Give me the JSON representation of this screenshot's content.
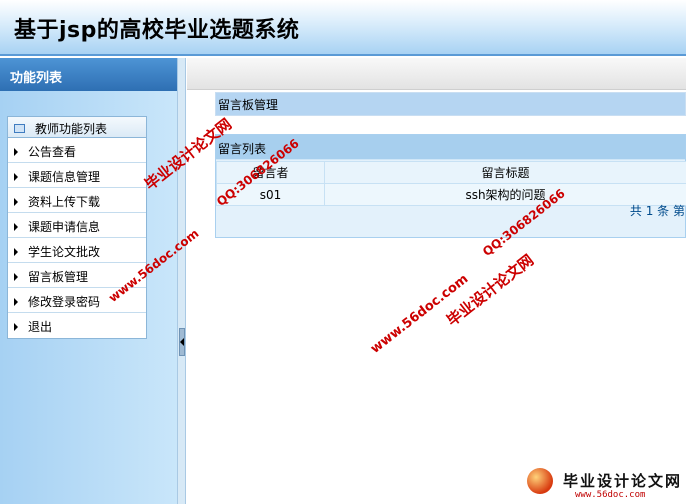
{
  "header": {
    "title": "基于jsp的高校毕业选题系统"
  },
  "sidebar": {
    "title": "功能列表",
    "group_label": "教师功能列表",
    "items": [
      {
        "label": "公告查看"
      },
      {
        "label": "课题信息管理"
      },
      {
        "label": "资料上传下载"
      },
      {
        "label": "课题申请信息"
      },
      {
        "label": "学生论文批改"
      },
      {
        "label": "留言板管理"
      },
      {
        "label": "修改登录密码"
      },
      {
        "label": "退出"
      }
    ]
  },
  "main": {
    "section_title": "留言板管理",
    "list_title": "留言列表",
    "columns": [
      "留言者",
      "留言标题"
    ],
    "rows": [
      {
        "author": "s01",
        "subject": "ssh架构的问题"
      }
    ],
    "pager": "共 1 条 第"
  },
  "watermarks": {
    "site": "毕业设计论文网",
    "qq": "QQ:306826066",
    "url": "www.56doc.com"
  },
  "logo": {
    "name": "毕业设计论文网",
    "url": "www.56doc.com"
  },
  "colors": {
    "accent": "#2e6fb3",
    "watermark": "#cc0000"
  }
}
